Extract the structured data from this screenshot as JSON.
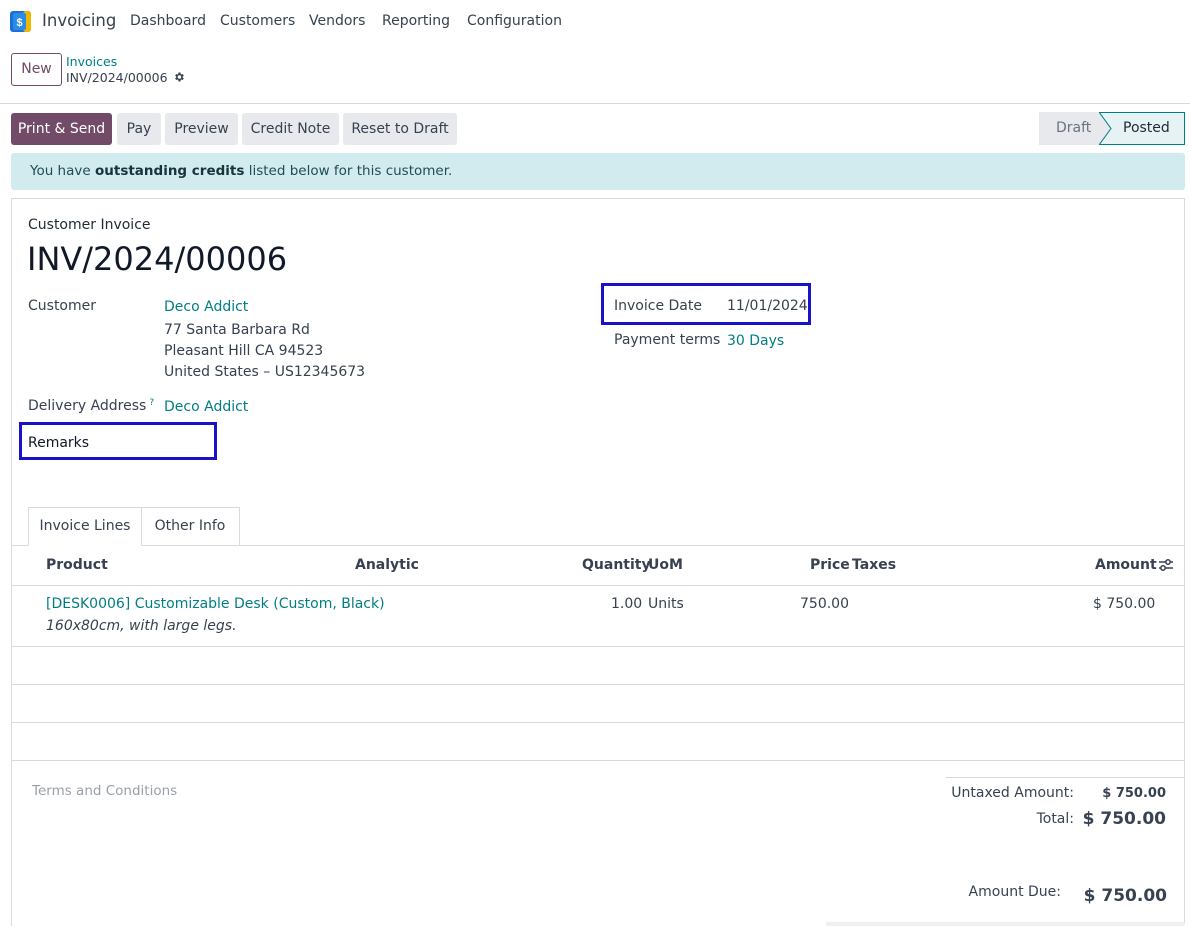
{
  "app": {
    "name": "Invoicing",
    "menu": [
      "Dashboard",
      "Customers",
      "Vendors",
      "Reporting",
      "Configuration"
    ]
  },
  "control": {
    "new_label": "New",
    "breadcrumb_parent": "Invoices",
    "breadcrumb_current": "INV/2024/00006"
  },
  "actions": {
    "print_send": "Print & Send",
    "pay": "Pay",
    "preview": "Preview",
    "credit_note": "Credit Note",
    "reset_to_draft": "Reset to Draft"
  },
  "status": {
    "draft": "Draft",
    "posted": "Posted"
  },
  "alert": {
    "prefix": "You have ",
    "bold": "outstanding credits",
    "suffix": " listed below for this customer."
  },
  "invoice": {
    "type_label": "Customer Invoice",
    "number": "INV/2024/00006",
    "customer_label": "Customer",
    "customer_name": "Deco Addict",
    "address_line1": "77 Santa Barbara Rd",
    "address_line2": "Pleasant Hill CA 94523",
    "address_line3": "United States – US12345673",
    "delivery_label": "Delivery Address",
    "delivery_help": "?",
    "delivery_value": "Deco Addict",
    "remarks_label": "Remarks",
    "invoice_date_label": "Invoice Date",
    "invoice_date_value": "11/01/2024",
    "payment_terms_label": "Payment terms",
    "payment_terms_value": "30 Days"
  },
  "tabs": {
    "invoice_lines": "Invoice Lines",
    "other_info": "Other Info"
  },
  "table": {
    "headers": {
      "product": "Product",
      "analytic": "Analytic",
      "quantity": "Quantity",
      "uom": "UoM",
      "price": "Price",
      "taxes": "Taxes",
      "amount": "Amount"
    },
    "rows": [
      {
        "product": "[DESK0006] Customizable Desk (Custom, Black)",
        "description": "160x80cm, with large legs.",
        "quantity": "1.00",
        "uom": "Units",
        "price": "750.00",
        "amount": "$ 750.00"
      }
    ]
  },
  "footer": {
    "terms_placeholder": "Terms and Conditions",
    "untaxed_label": "Untaxed Amount:",
    "untaxed_value": "$ 750.00",
    "total_label": "Total:",
    "total_value": "$ 750.00",
    "amount_due_label": "Amount Due:",
    "amount_due_value": "$ 750.00"
  },
  "colors": {
    "brand": "#714b67",
    "link": "#017e84",
    "highlight": "#1a12c9",
    "alert_bg": "#d2ebef"
  }
}
